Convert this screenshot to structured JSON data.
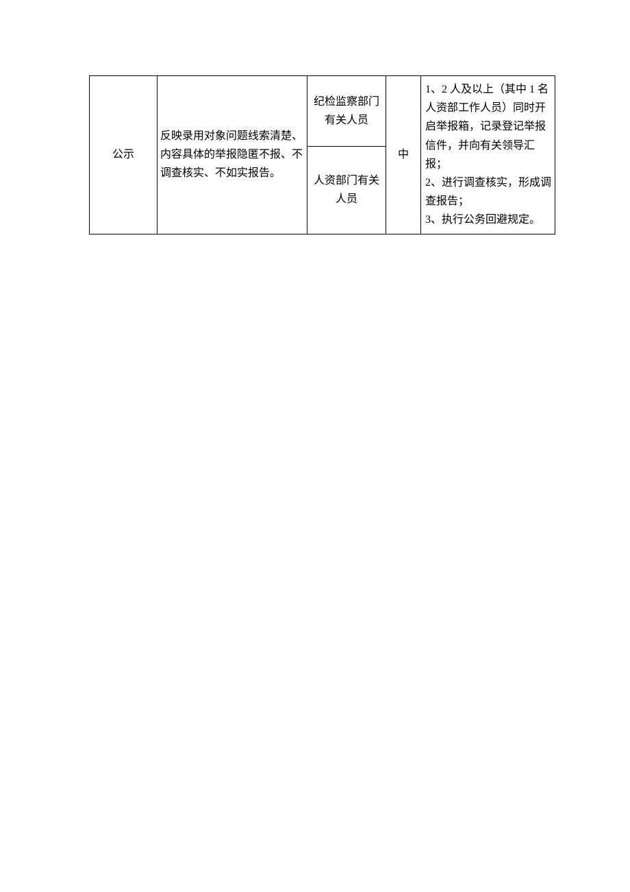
{
  "row": {
    "col1": "公示",
    "col2": "反映录用对象问题线索清楚、内容具体的举报隐匿不报、不调查核实、不如实报告。",
    "col3_top": "纪检监察部门有关人员",
    "col3_bottom": "人资部门有关人员",
    "col4": "中",
    "col5": "1、2 人及以上（其中 1 名人资部工作人员）同时开启举报箱，记录登记举报信件，并向有关领导汇报；\n2、进行调查核实，形成调查报告；\n3、执行公务回避规定。"
  }
}
